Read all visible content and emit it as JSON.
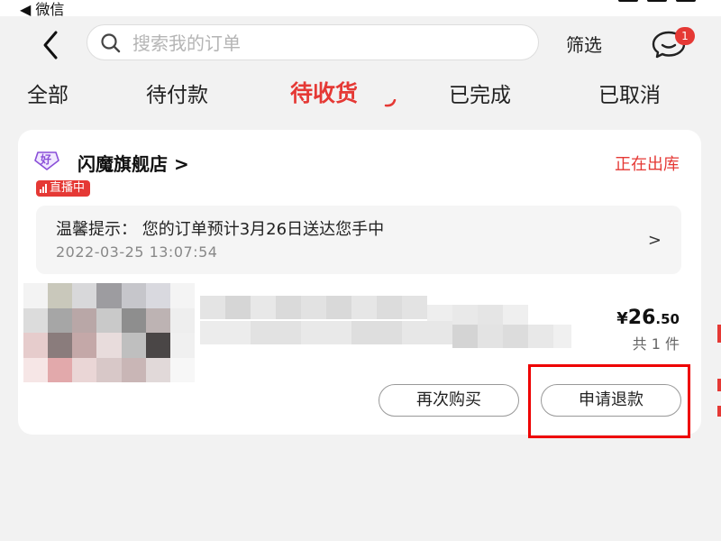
{
  "status_bar": {
    "back_label": "◀ 微信"
  },
  "header": {
    "search_placeholder": "搜索我的订单",
    "filter_label": "筛选",
    "message_badge": "1"
  },
  "tabs": [
    {
      "label": "全部",
      "active": false
    },
    {
      "label": "待付款",
      "active": false
    },
    {
      "label": "待收货",
      "active": true
    },
    {
      "label": "已完成",
      "active": false
    },
    {
      "label": "已取消",
      "active": false
    }
  ],
  "order": {
    "shop_name": "闪魔旗舰店 >",
    "shop_icon_label": "好",
    "status": "正在出库",
    "live_badge": "直播中",
    "tip_text": "温馨提示： 您的订单预计3月26日送达您手中",
    "tip_time": "2022-03-25 13:07:54",
    "price_currency": "¥",
    "price_integer": "26",
    "price_decimal": ".50",
    "quantity": "共 1 件",
    "rebuy_label": "再次购买",
    "refund_label": "申请退款"
  },
  "colors": {
    "accent": "#e53935",
    "background": "#f2f2f2",
    "card": "#ffffff",
    "annotation": "#ee0000"
  }
}
